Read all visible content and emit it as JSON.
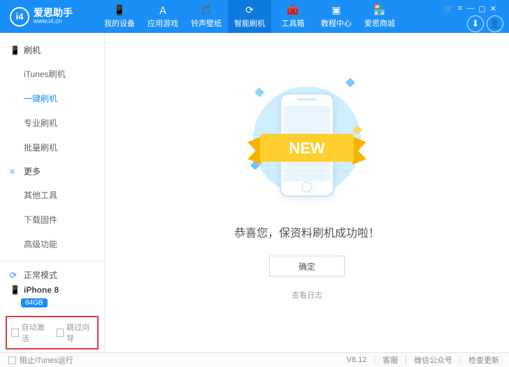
{
  "header": {
    "logo": {
      "mark": "i4",
      "name": "爱思助手",
      "url": "www.i4.cn"
    },
    "nav": [
      {
        "icon": "📱",
        "label": "我的设备"
      },
      {
        "icon": "Ａ",
        "label": "应用游戏"
      },
      {
        "icon": "🎵",
        "label": "铃声壁纸"
      },
      {
        "icon": "⟳",
        "label": "智能刷机",
        "active": true
      },
      {
        "icon": "🧰",
        "label": "工具箱"
      },
      {
        "icon": "▣",
        "label": "教程中心"
      },
      {
        "icon": "🏪",
        "label": "爱思商城"
      }
    ],
    "win": {
      "menu": "≡",
      "cart": "🛒",
      "min": "—",
      "max": "▢",
      "close": "✕"
    }
  },
  "sidebar": {
    "groups": [
      {
        "icon": "📱",
        "title": "刷机",
        "items": [
          {
            "label": "iTunes刷机"
          },
          {
            "label": "一键刷机",
            "active": true
          },
          {
            "label": "专业刷机"
          },
          {
            "label": "批量刷机"
          }
        ]
      },
      {
        "icon": "≡",
        "title": "更多",
        "items": [
          {
            "label": "其他工具"
          },
          {
            "label": "下载固件"
          },
          {
            "label": "高级功能"
          }
        ]
      }
    ],
    "device": {
      "mode_icon": "⟳",
      "mode": "正常模式",
      "phone_icon": "📱",
      "model": "iPhone 8",
      "storage": "64GB"
    },
    "checks": {
      "auto_activate": "自动激活",
      "skip_guide": "跳过向导"
    }
  },
  "main": {
    "ribbon": "NEW",
    "success": "恭喜您，保资料刷机成功啦！",
    "ok": "确定",
    "view_log": "查看日志"
  },
  "footer": {
    "block_itunes": "阻止iTunes运行",
    "version": "V8.12",
    "service": "客服",
    "wechat": "微信公众号",
    "update": "检查更新"
  }
}
